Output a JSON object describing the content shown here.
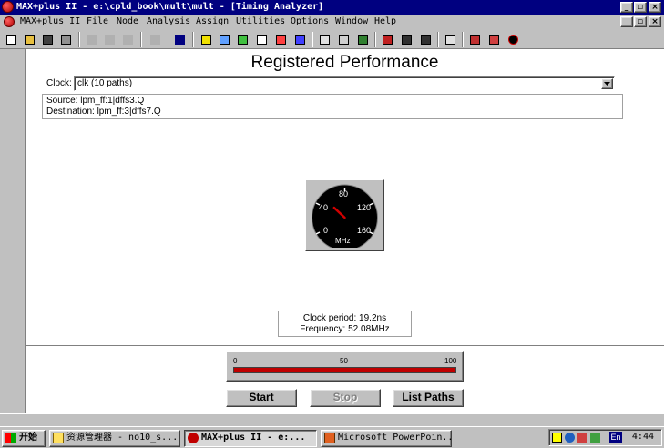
{
  "window": {
    "title": "MAX+plus II - e:\\cpld_book\\mult\\mult - [Timing Analyzer]"
  },
  "menu": {
    "items": [
      "MAX+plus II",
      "File",
      "Node",
      "Analysis",
      "Assign",
      "Utilities",
      "Options",
      "Window",
      "Help"
    ]
  },
  "toolbar": {
    "icons": [
      "new-icon",
      "open-icon",
      "save-icon",
      "print-icon",
      "cut-icon",
      "copy-icon",
      "paste-icon",
      "undo-icon",
      "help-icon",
      "hierarchy-up-icon",
      "hierarchy-display-icon",
      "floorplan-editor-icon",
      "compiler-icon",
      "simulator-icon",
      "timing-analyzer-icon",
      "programmer-icon",
      "open-editor-icon",
      "save-check-icon",
      "save-compile-icon",
      "save-simulate-icon",
      "project-save-icon",
      "timing-icon",
      "table-icon",
      "chip-icon",
      "gauge-icon"
    ]
  },
  "analyzer": {
    "title": "Registered Performance",
    "clock_label": "Clock:",
    "clock_value": "clk (10 paths)",
    "source": "Source: lpm_ff:1|dffs3.Q",
    "destination": "Destination: lpm_ff:3|dffs7.Q",
    "gauge": {
      "labels": [
        "0",
        "40",
        "80",
        "120",
        "160"
      ],
      "unit": "MHz",
      "value_mhz": 52.08
    },
    "clock_period": "Clock period: 19.2ns",
    "frequency": "Frequency: 52.08MHz",
    "progress": {
      "labels": [
        "0",
        "50",
        "100"
      ],
      "fraction": 1.0
    },
    "buttons": {
      "start": "Start",
      "stop": "Stop",
      "list_paths": "List Paths"
    }
  },
  "taskbar": {
    "start": "开始",
    "tasks": [
      {
        "label": "资源管理器 - no10_s...",
        "icon": "explorer-icon"
      },
      {
        "label": "MAX+plus II - e:...",
        "icon": "maxplus-icon"
      },
      {
        "label": "Microsoft PowerPoin...",
        "icon": "powerpoint-icon"
      }
    ],
    "tray_lang": "En",
    "time": "4:44"
  },
  "colors": {
    "titlebar": "#000080",
    "progress_fill": "#c00000",
    "gauge_face": "#000000",
    "needle": "#d00000"
  }
}
